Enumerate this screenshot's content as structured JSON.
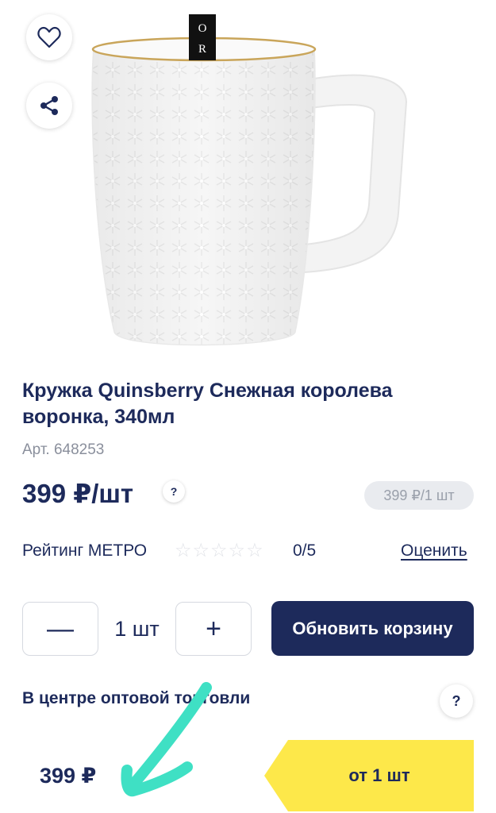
{
  "product": {
    "title": "Кружка Quinsberry Снежная королева воронка, 340мл",
    "sku": "Арт. 648253",
    "price": "399 ₽/шт",
    "unit_price": "399 ₽/1 шт",
    "mug_band_text": "O R"
  },
  "rating": {
    "label": "Рейтинг МЕТРО",
    "value": "0/5",
    "stars_filled": 0,
    "stars_total": 5,
    "rate_link": "Оценить"
  },
  "quantity": {
    "minus_label": "—",
    "value": "1 шт",
    "plus_label": "+"
  },
  "cart": {
    "update_label": "Обновить корзину"
  },
  "wholesale": {
    "title": "В центре оптовой торговли",
    "help_label": "?",
    "price": "399 ₽",
    "tier_label": "от 1 шт"
  },
  "help": {
    "label": "?"
  },
  "colors": {
    "navy": "#1d2a5b",
    "yellow": "#fde84a",
    "arrow": "#3fe0c4",
    "muted": "#8a8f9c"
  },
  "icons": {
    "favorite": "heart-icon",
    "share": "share-icon",
    "star": "star-icon"
  }
}
